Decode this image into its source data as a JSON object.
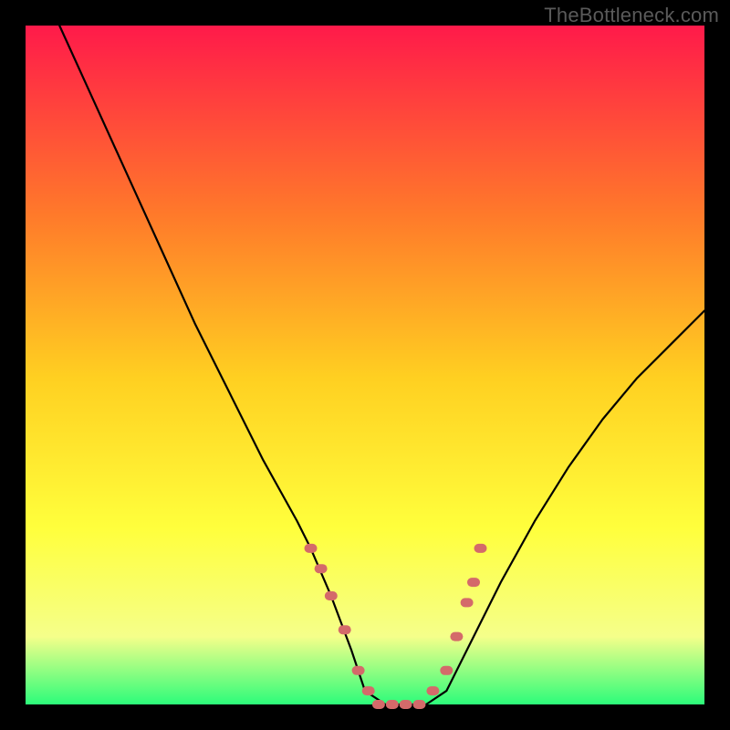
{
  "watermark": "TheBottleneck.com",
  "colors": {
    "frame": "#000000",
    "gradient_top": "#ff1a4a",
    "gradient_upper_mid": "#ff7a2a",
    "gradient_mid": "#ffd021",
    "gradient_lower_mid": "#ffff3c",
    "gradient_lower": "#f5ff8a",
    "gradient_bottom": "#2cfc7a",
    "curve": "#000000",
    "marker": "#d46a6a"
  },
  "chart_data": {
    "type": "line",
    "title": "",
    "xlabel": "",
    "ylabel": "",
    "xlim": [
      0,
      100
    ],
    "ylim": [
      0,
      100
    ],
    "series": [
      {
        "name": "bottleneck-curve",
        "x": [
          5,
          10,
          15,
          20,
          25,
          30,
          35,
          40,
          42,
          45,
          48,
          50,
          53,
          56,
          59,
          62,
          65,
          70,
          75,
          80,
          85,
          90,
          95,
          100
        ],
        "y": [
          100,
          89,
          78,
          67,
          56,
          46,
          36,
          27,
          23,
          16,
          8,
          2,
          0,
          0,
          0,
          2,
          8,
          18,
          27,
          35,
          42,
          48,
          53,
          58
        ]
      }
    ],
    "highlighted_points": {
      "name": "optimal-range-markers",
      "x": [
        42,
        43.5,
        45,
        47,
        49,
        50.5,
        52,
        54,
        56,
        58,
        60,
        62,
        63.5,
        65,
        66,
        67
      ],
      "y": [
        23,
        20,
        16,
        11,
        5,
        2,
        0,
        0,
        0,
        0,
        2,
        5,
        10,
        15,
        18,
        23
      ]
    }
  }
}
